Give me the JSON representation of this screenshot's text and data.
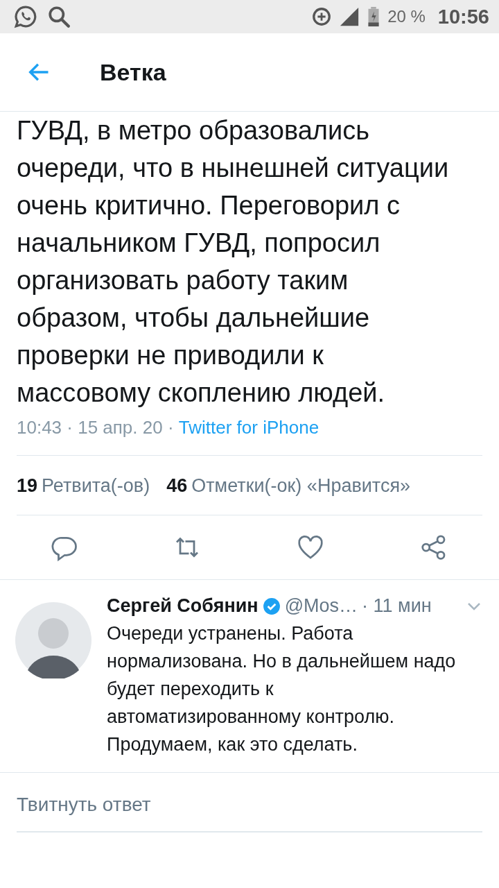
{
  "status_bar": {
    "battery": "20 %",
    "time": "10:56"
  },
  "header": {
    "title": "Ветка"
  },
  "tweet": {
    "text": "ГУВД, в метро образовались очереди, что в нынешней ситуации очень критично. Переговорил с начальником ГУВД, попросил организовать работу таким образом, чтобы дальнейшие проверки не приводили к массовому скоплению людей.",
    "time": "10:43 · 15 апр. 20 ·",
    "source": "Twitter for iPhone",
    "stats": [
      {
        "count": "19",
        "label": "Ретвита(-ов)"
      },
      {
        "count": "46",
        "label": "Отметки(-ок) «Нравится»"
      }
    ]
  },
  "reply": {
    "name": "Сергей Собянин",
    "verified": true,
    "handle": "@Mos…",
    "time": "· 11 мин",
    "text": "Очереди устранены. Работа нормализована. Но в дальнейшем надо будет переходить к автоматизированному контролю. Продумаем, как это сделать."
  },
  "composer": {
    "placeholder": "Твитнуть ответ"
  }
}
